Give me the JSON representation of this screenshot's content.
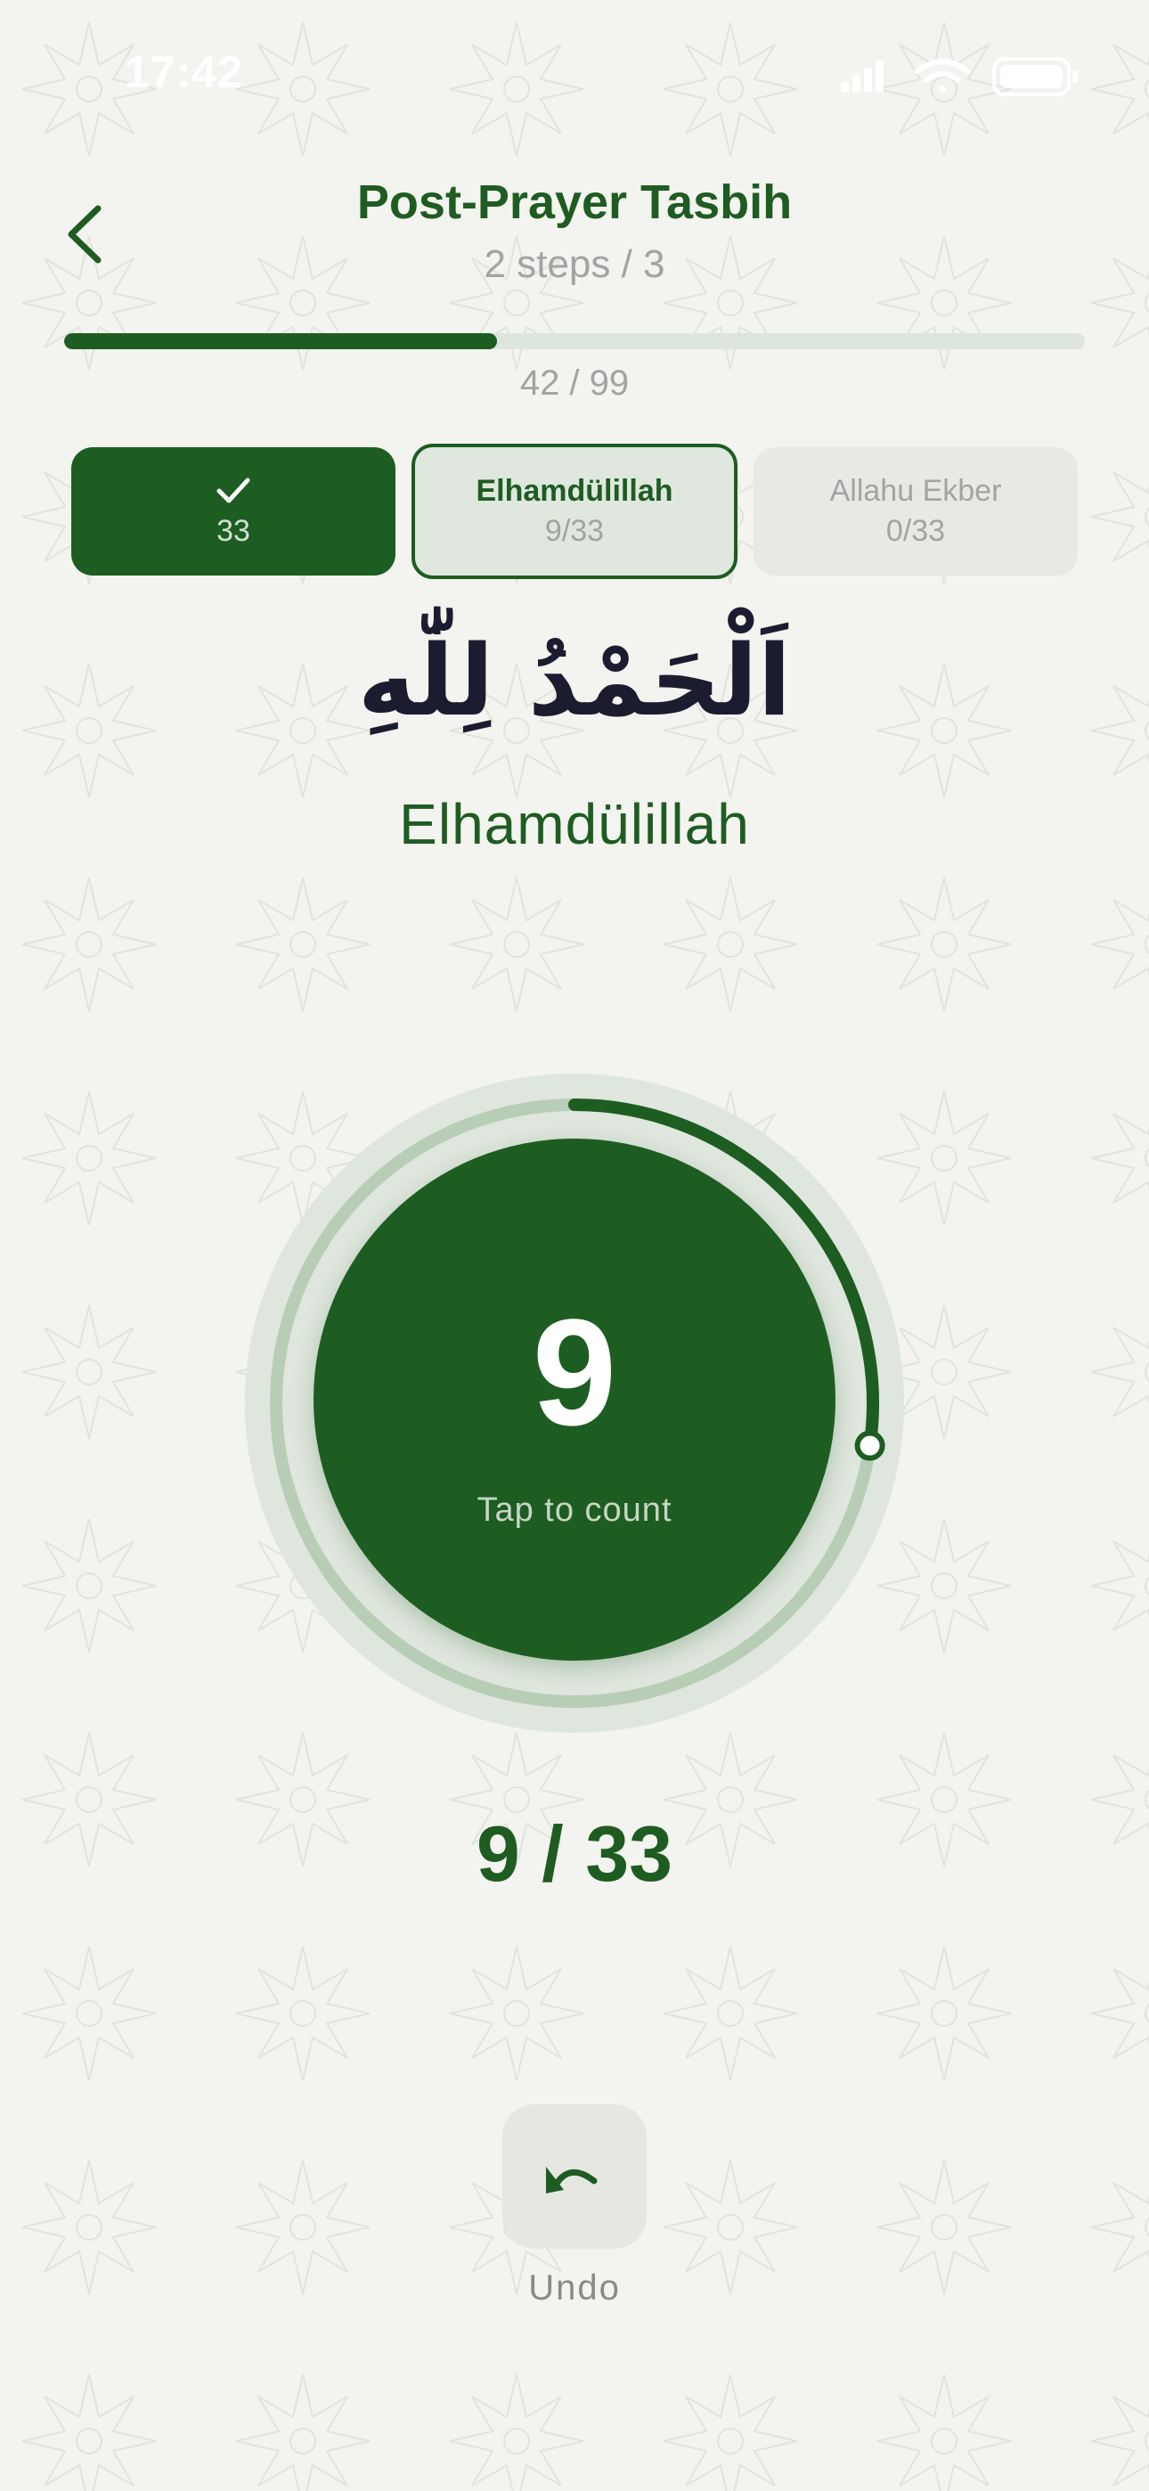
{
  "status_bar": {
    "time": "17:42",
    "icons": [
      "signal-icon",
      "wifi-icon",
      "battery-icon"
    ]
  },
  "header": {
    "back_icon": "chevron-left-icon",
    "title": "Post-Prayer Tasbih",
    "subtitle": "2 steps / 3"
  },
  "progress": {
    "fraction": 0.4242,
    "text": "42 / 99"
  },
  "steps": [
    {
      "title": "",
      "icon": "check-icon",
      "count": "33",
      "state": "completed"
    },
    {
      "title": "Elhamdülillah",
      "count": "9/33",
      "state": "active"
    },
    {
      "title": "Allahu Ekber",
      "count": "0/33",
      "state": "pending"
    }
  ],
  "dhikr": {
    "arabic": "اَلْحَمْدُ لِلّٰهِ",
    "transliteration": "Elhamdülillah"
  },
  "counter": {
    "value": "9",
    "hint": "Tap to count",
    "progress_fraction": 0.2727,
    "display": "9 / 33"
  },
  "undo": {
    "icon": "undo-icon",
    "label": "Undo"
  },
  "colors": {
    "primary": "#1d5d21",
    "background": "#f3f3ef",
    "muted_text": "#a3a3a3",
    "track": "#dde5dc"
  }
}
